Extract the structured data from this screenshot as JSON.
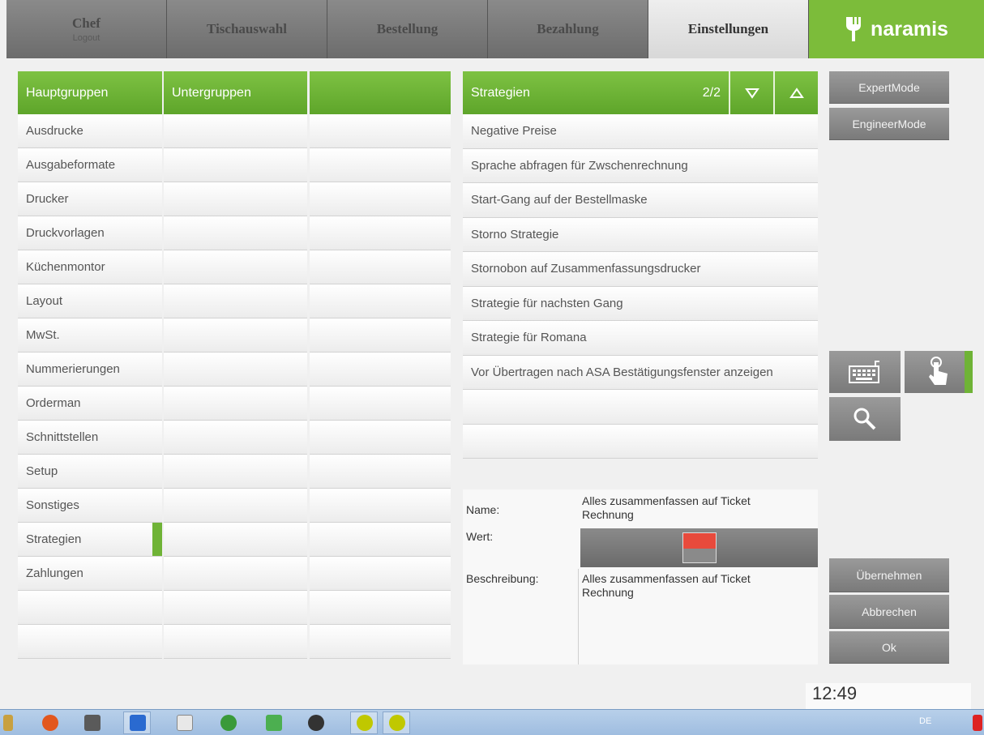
{
  "nav": {
    "user": "Chef",
    "logout": "Logout",
    "tabs": [
      "Tischauswahl",
      "Bestellung",
      "Bezahlung",
      "Einstellungen"
    ],
    "active_tab": "Einstellungen",
    "brand": "naramis"
  },
  "columns": {
    "hauptgruppen_header": "Hauptgruppen",
    "untergruppen_header": "Untergruppen",
    "third_header": "",
    "hauptgruppen": [
      "Ausdrucke",
      "Ausgabeformate",
      "Drucker",
      "Druckvorlagen",
      "Küchenmontor",
      "Layout",
      "MwSt.",
      "Nummerierungen",
      "Orderman",
      "Schnittstellen",
      "Setup",
      "Sonstiges",
      "Strategien",
      "Zahlungen",
      "",
      ""
    ],
    "selected": "Strategien"
  },
  "strategies": {
    "header": "Strategien",
    "page": "2/2",
    "down_icon": "triangle-down-icon",
    "up_icon": "triangle-up-icon",
    "items": [
      "Negative Preise",
      "Sprache abfragen für Zwschenrechnung",
      "Start-Gang auf der Bestellmaske",
      "Storno Strategie",
      "Stornobon auf Zusammenfassungsdrucker",
      "Strategie für nachsten Gang",
      "Strategie für Romana",
      "Vor Übertragen nach ASA Bestätigungsfenster anzeigen",
      "",
      ""
    ]
  },
  "detail": {
    "name_label": "Name:",
    "name_value_1": "Alles zusammenfassen auf Ticket",
    "name_value_2": "Rechnung",
    "wert_label": "Wert:",
    "wert_on": true,
    "beschreibung_label": "Beschreibung:",
    "beschreibung_value_1": "Alles zusammenfassen auf Ticket",
    "beschreibung_value_2": "Rechnung"
  },
  "right": {
    "expert": "ExpertMode",
    "engineer": "EngineerMode",
    "keyboard_icon": "keyboard-icon",
    "touch_icon": "touch-icon",
    "search_icon": "search-icon",
    "apply": "Übernehmen",
    "cancel": "Abbrechen",
    "ok": "Ok"
  },
  "clock": "12:49",
  "taskbar": {
    "lang": "DE"
  },
  "colors": {
    "green": "#6fb336",
    "toggle_on": "#e84a3c",
    "brand": "#7cbc3a"
  }
}
